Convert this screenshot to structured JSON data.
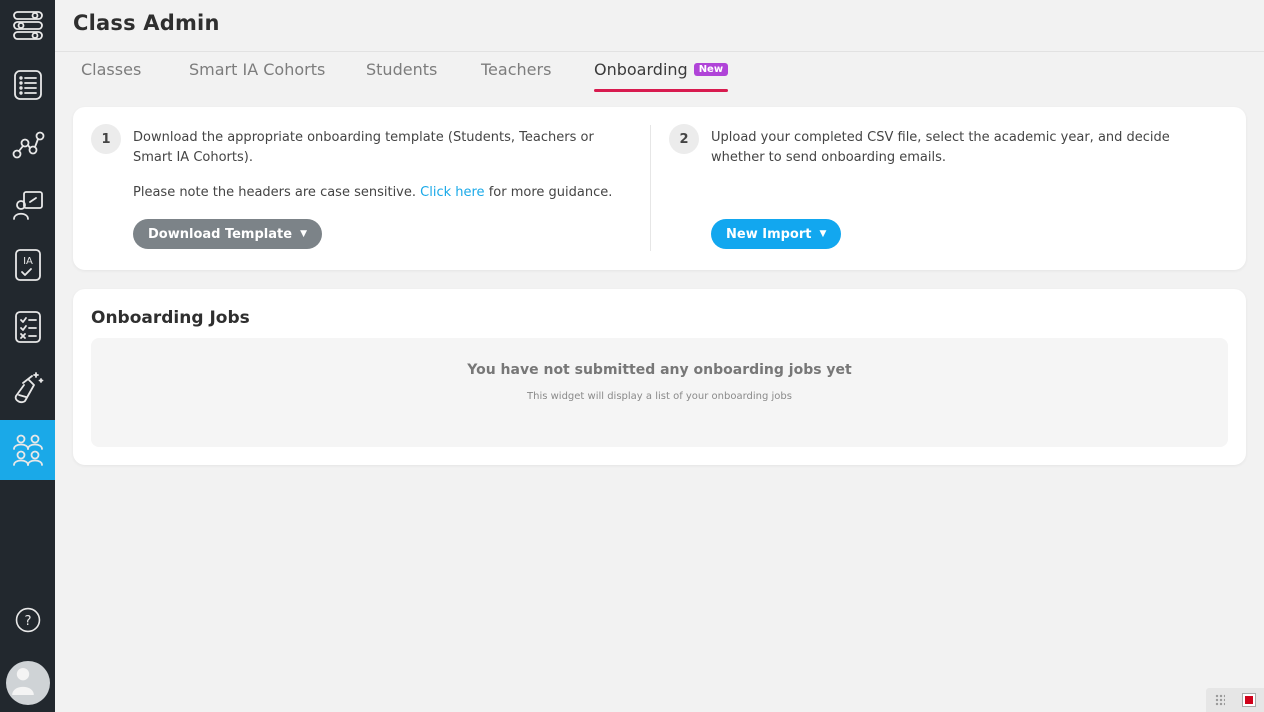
{
  "header": {
    "title": "Class Admin"
  },
  "tabs": [
    {
      "label": "Classes"
    },
    {
      "label": "Smart IA Cohorts"
    },
    {
      "label": "Students"
    },
    {
      "label": "Teachers"
    },
    {
      "label": "Onboarding",
      "badge": "New",
      "active": true
    }
  ],
  "steps": {
    "step1": {
      "number": "1",
      "text": "Download the appropriate onboarding template (Students, Teachers or Smart IA Cohorts).",
      "note_prefix": "Please note the headers are case sensitive.",
      "note_link": "Click here",
      "note_suffix": "for more guidance.",
      "button_label": "Download Template"
    },
    "step2": {
      "number": "2",
      "text": "Upload your completed CSV file, select the academic year, and decide whether to send onboarding emails.",
      "button_label": "New Import"
    }
  },
  "jobs": {
    "title": "Onboarding Jobs",
    "empty_title": "You have not submitted any onboarding jobs yet",
    "empty_subtitle": "This widget will display a list of your onboarding jobs"
  },
  "sidebar": {
    "items": [
      {
        "icon": "sliders-icon"
      },
      {
        "icon": "list-icon"
      },
      {
        "icon": "nodes-icon"
      },
      {
        "icon": "presenter-icon"
      },
      {
        "icon": "ia-icon",
        "glyph": "IA"
      },
      {
        "icon": "checklist-icon"
      },
      {
        "icon": "flask-icon"
      },
      {
        "icon": "users-icon",
        "active": true
      }
    ],
    "help_glyph": "?"
  },
  "colors": {
    "accent": "#1aa9e8",
    "tab_underline": "#d81b4f",
    "badge": "#b044d8",
    "sidebar": "#22282e"
  }
}
